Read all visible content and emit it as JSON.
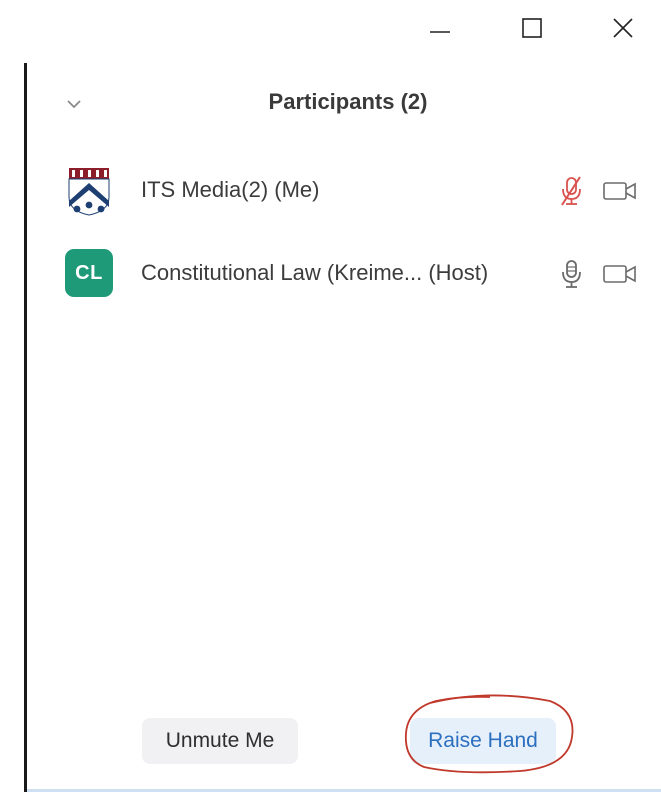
{
  "window_controls": {
    "minimize_icon": "minimize-icon",
    "maximize_icon": "maximize-icon",
    "close_icon": "close-icon"
  },
  "panel": {
    "title": "Participants (2)",
    "collapse_icon": "chevron-down-icon"
  },
  "participants": [
    {
      "name": "ITS Media(2) (Me)",
      "avatar": "university-shield-logo",
      "mic_state": "muted",
      "mic_icon": "microphone-muted-icon",
      "cam_icon": "video-camera-icon"
    },
    {
      "name": "Constitutional Law (Kreime... (Host)",
      "avatar_initials": "CL",
      "avatar_color": "#1f9a78",
      "mic_state": "unmuted",
      "mic_icon": "microphone-icon",
      "cam_icon": "video-camera-icon"
    }
  ],
  "footer": {
    "unmute_label": "Unmute Me",
    "raise_hand_label": "Raise Hand"
  },
  "colors": {
    "muted_mic": "#d9534f",
    "raise_hand_text": "#2d6fbf",
    "annotation": "#c0392b"
  }
}
